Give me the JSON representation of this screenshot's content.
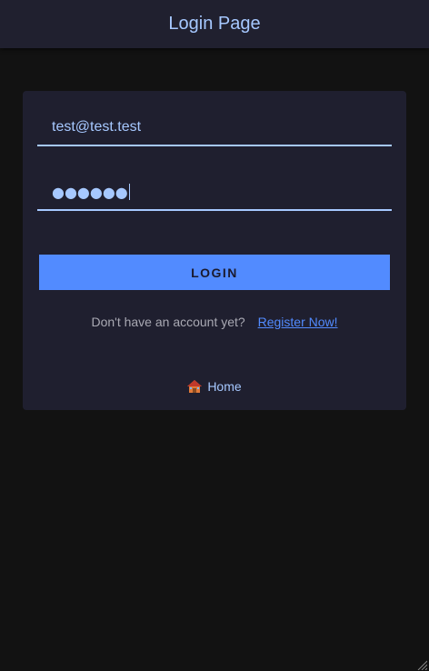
{
  "header": {
    "title": "Login Page"
  },
  "form": {
    "email_value": "test@test.test",
    "password_masked": "●●●●●●",
    "login_label": "LOGIN"
  },
  "register": {
    "prompt": "Don't have an account yet?",
    "link_label": "Register Now!"
  },
  "home": {
    "label": "Home",
    "icon": "house-icon"
  },
  "colors": {
    "background": "#121212",
    "header_bg": "#20202f",
    "card_bg": "#1f1f2f",
    "accent": "#528bff",
    "text_light": "#a6c8ff",
    "muted": "#a9a9b3"
  }
}
